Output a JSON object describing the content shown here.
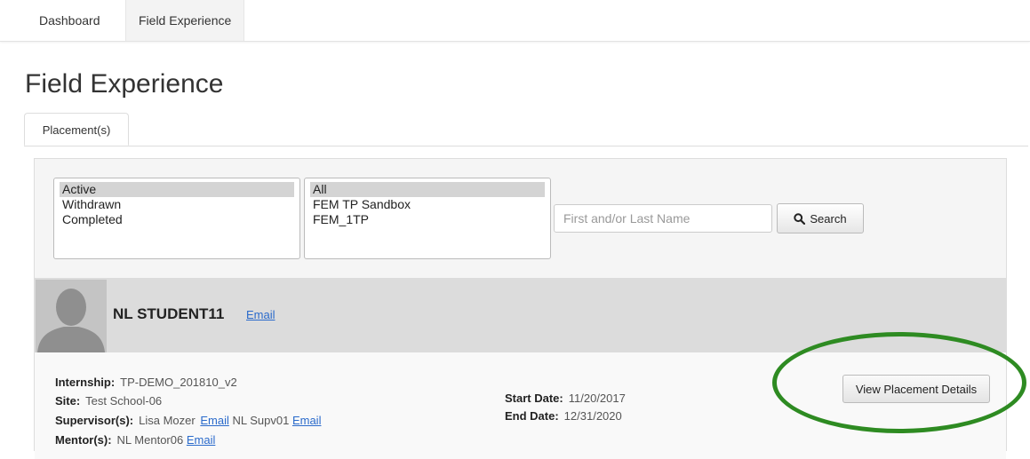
{
  "topnav": {
    "tabs": [
      {
        "label": "Dashboard"
      },
      {
        "label": "Field Experience"
      }
    ]
  },
  "page": {
    "title": "Field Experience",
    "subtab_label": "Placement(s)"
  },
  "filters": {
    "status_options": [
      "Active",
      "Withdrawn",
      "Completed"
    ],
    "status_selected": "Active",
    "program_options": [
      "All",
      "FEM TP Sandbox",
      "FEM_1TP"
    ],
    "program_selected": "All",
    "name_placeholder": "First and/or Last Name",
    "search_label": "Search"
  },
  "student": {
    "name": "NL STUDENT11",
    "email_link": "Email",
    "internship_label": "Internship:",
    "internship_value": "TP-DEMO_201810_v2",
    "site_label": "Site:",
    "site_value": "Test School-06",
    "supervisors_label": "Supervisor(s):",
    "supervisor1_name": "Lisa Mozer",
    "supervisor1_email": "Email",
    "supervisor2_name": "NL Supv01",
    "supervisor2_email": "Email",
    "mentors_label": "Mentor(s):",
    "mentor_name": "NL Mentor06",
    "mentor_email": "Email",
    "start_label": "Start Date:",
    "start_value": "11/20/2017",
    "end_label": "End Date:",
    "end_value": "12/31/2020",
    "view_details_label": "View Placement Details"
  },
  "colors": {
    "highlight_ellipse": "#2e8b22",
    "link": "#2a6acb"
  }
}
